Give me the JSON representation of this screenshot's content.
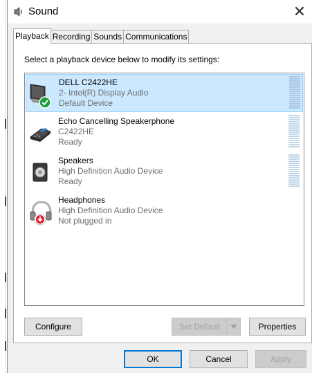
{
  "window": {
    "title": "Sound"
  },
  "tabs": [
    {
      "label": "Playback",
      "active": true
    },
    {
      "label": "Recording",
      "active": false
    },
    {
      "label": "Sounds",
      "active": false
    },
    {
      "label": "Communications",
      "active": false
    }
  ],
  "instruction": "Select a playback device below to modify its settings:",
  "devices": [
    {
      "name": "DELL C2422HE",
      "line2": "2- Intel(R) Display Audio",
      "line3": "Default Device",
      "icon": "monitor-speaker-icon",
      "status_icon": "checkmark-badge-icon",
      "selected": true
    },
    {
      "name": "Echo Cancelling Speakerphone",
      "line2": "C2422HE",
      "line3": "Ready",
      "icon": "speakerphone-icon",
      "selected": false
    },
    {
      "name": "Speakers",
      "line2": "High Definition Audio Device",
      "line3": "Ready",
      "icon": "speaker-icon",
      "selected": false
    },
    {
      "name": "Headphones",
      "line2": "High Definition Audio Device",
      "line3": "Not plugged in",
      "icon": "headphones-icon",
      "status_icon": "unplugged-badge-icon",
      "selected": false
    }
  ],
  "buttons": {
    "configure": "Configure",
    "set_default": "Set Default",
    "properties": "Properties",
    "ok": "OK",
    "cancel": "Cancel",
    "apply": "Apply"
  },
  "colors": {
    "selection_bg": "#cce8ff",
    "selection_border": "#99d1ff",
    "accent": "#0078d7",
    "check_green": "#16a34a",
    "unplugged_red": "#e81123"
  }
}
